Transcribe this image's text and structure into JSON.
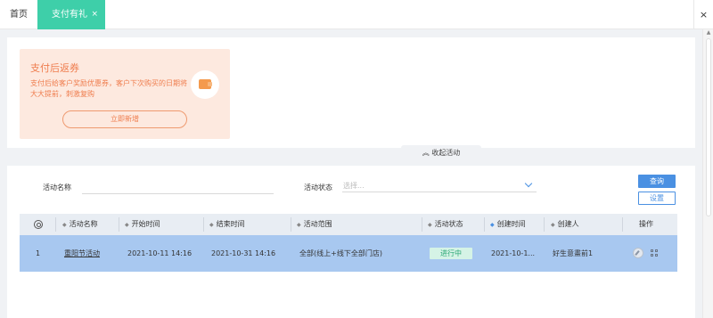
{
  "tabs": {
    "home_label": "首页",
    "active_label": "支付有礼",
    "active_close": "×",
    "right_close": "×"
  },
  "promo": {
    "title": "支付后返券",
    "description": "支付后给客户奖励优惠券，客户下次购买的日期将大大提前，刺激复购",
    "button_label": "立即新增",
    "icon": "wallet-icon"
  },
  "collapse": {
    "label": "收起活动",
    "icon": "chevron-up-icon"
  },
  "filters": {
    "name_label": "活动名称",
    "name_value": "",
    "status_label": "活动状态",
    "status_placeholder": "选择..."
  },
  "actions": {
    "query_label": "查询",
    "settings_label": "设置"
  },
  "table": {
    "columns": [
      "",
      "活动名称",
      "开始时间",
      "结束时间",
      "活动范围",
      "活动状态",
      "创建时间",
      "创建人",
      "操作"
    ],
    "rows": [
      {
        "index": "1",
        "name": "重阳节活动",
        "start": "2021-10-11 14:16",
        "end": "2021-10-31 14:16",
        "scope": "全部(线上+线下全部门店)",
        "status": "进行中",
        "created": "2021-10-1...",
        "creator": "好生意畫前1"
      }
    ]
  },
  "colors": {
    "tab_active": "#3ecfa9",
    "promo_bg": "#fde9df",
    "promo_text": "#ef7d4e",
    "primary": "#4a90e2",
    "row_selected": "#a8c8f0",
    "status_bg": "#d5f3e6",
    "status_text": "#2aa774"
  }
}
